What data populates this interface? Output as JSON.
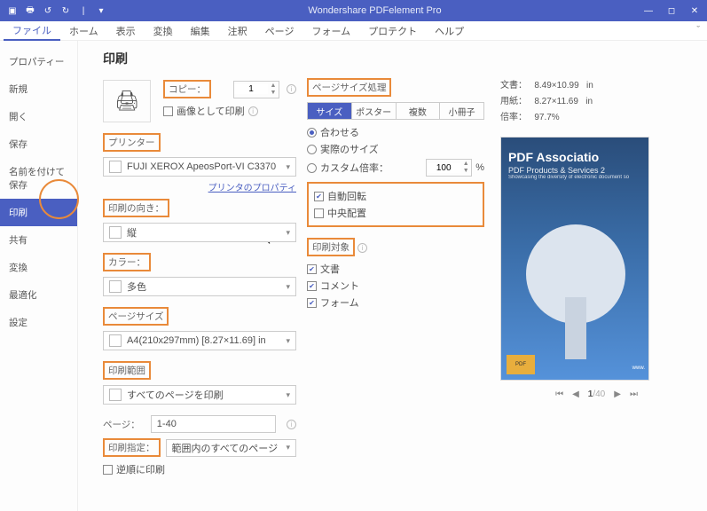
{
  "app": {
    "title": "Wondershare PDFelement Pro"
  },
  "menubar": [
    "ファイル",
    "ホーム",
    "表示",
    "変換",
    "編集",
    "注釈",
    "ページ",
    "フォーム",
    "プロテクト",
    "ヘルプ"
  ],
  "sidebar": [
    "プロパティー",
    "新規",
    "開く",
    "保存",
    "名前を付けて保存",
    "印刷",
    "共有",
    "変換",
    "最適化",
    "設定"
  ],
  "page_title": "印刷",
  "copy": {
    "label": "コピー：",
    "value": "1",
    "print_as_image": "画像として印刷"
  },
  "printer": {
    "label": "プリンター",
    "value": "FUJI XEROX ApeosPort-VI C3370",
    "props": "プリンタのプロパティ"
  },
  "orient": {
    "label": "印刷の向き：",
    "value": "縦"
  },
  "color": {
    "label": "カラー：",
    "value": "多色"
  },
  "pagesize": {
    "label": "ページサイズ",
    "value": "A4(210x297mm) [8.27×11.69] in"
  },
  "range": {
    "label": "印刷範囲",
    "value": "すべてのページを印刷",
    "page_lbl": "ページ：",
    "page_val": "1-40",
    "mode_lbl": "印刷指定：",
    "mode_val": "範囲内のすべてのページ",
    "reverse": "逆順に印刷"
  },
  "sizehandle": {
    "label": "ページサイズ処理",
    "tabs": [
      "サイズ",
      "ポスター",
      "複数",
      "小冊子"
    ],
    "opts": [
      "合わせる",
      "実際のサイズ",
      "カスタム倍率："
    ],
    "custom_val": "100",
    "pct": "%",
    "auto_rot": "自動回転",
    "center": "中央配置"
  },
  "target": {
    "label": "印刷対象",
    "doc": "文書",
    "comment": "コメント",
    "form": "フォーム"
  },
  "docinfo": {
    "l1": "文書：",
    "v1": "8.49×10.99",
    "u1": "in",
    "l2": "用紙：",
    "v2": "8.27×11.69",
    "u2": "in",
    "l3": "倍率：",
    "v3": "97.7%"
  },
  "preview": {
    "h1": "PDF Associatio",
    "h2": "PDF Products & Services 2",
    "h3": "Showcasing the diversity of electronic document so",
    "badge": "PDF",
    "url": "www."
  },
  "pager": {
    "cur": "1",
    "total": "/40"
  }
}
